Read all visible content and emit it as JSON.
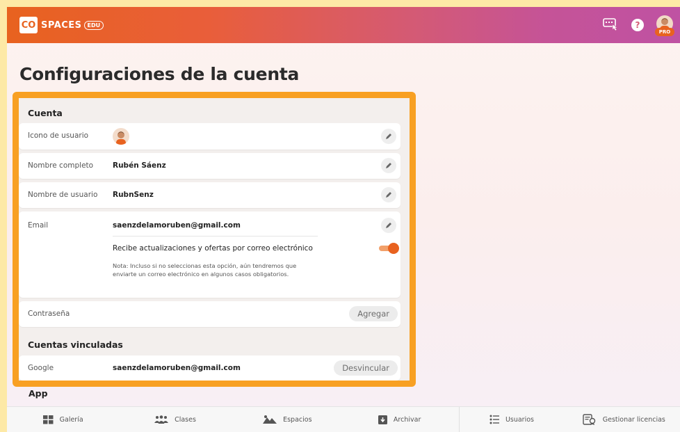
{
  "header": {
    "logo_mark": "CO",
    "logo_text": "SPACES",
    "logo_badge": "EDU",
    "help_glyph": "?",
    "pro_badge": "PRO",
    "accent_color": "#e8621f",
    "icons": [
      "keyboard-shortcuts-icon",
      "help-icon",
      "user-avatar"
    ]
  },
  "page": {
    "title": "Configuraciones de la cuenta"
  },
  "account": {
    "section_title": "Cuenta",
    "user_icon_label": "Icono de usuario",
    "full_name_label": "Nombre completo",
    "full_name_value": "Rubén Sáenz",
    "username_label": "Nombre de usuario",
    "username_value": "RubnSenz",
    "email_label": "Email",
    "email_value": "saenzdelamoruben@gmail.com",
    "newsletter_label": "Recibe actualizaciones y ofertas por correo electrónico",
    "newsletter_enabled": true,
    "note_line1": "Nota: Incluso si no seleccionas esta opción, aún tendremos que",
    "note_line2": "enviarte un correo electrónico en algunos casos obligatorios.",
    "password_label": "Contraseña",
    "password_button": "Agregar"
  },
  "linked": {
    "section_title": "Cuentas vinculadas",
    "google_label": "Google",
    "google_value": "saenzdelamoruben@gmail.com",
    "unlink_button": "Desvincular"
  },
  "app_section": {
    "title": "App"
  },
  "bottom_nav": {
    "items": [
      {
        "label": "Galería",
        "icon": "gallery-icon"
      },
      {
        "label": "Clases",
        "icon": "classes-icon"
      },
      {
        "label": "Espacios",
        "icon": "spaces-icon"
      },
      {
        "label": "Archivar",
        "icon": "archive-icon"
      },
      {
        "label": "Usuarios",
        "icon": "users-icon"
      },
      {
        "label": "Gestionar licencias",
        "icon": "manage-licenses-icon"
      }
    ]
  }
}
